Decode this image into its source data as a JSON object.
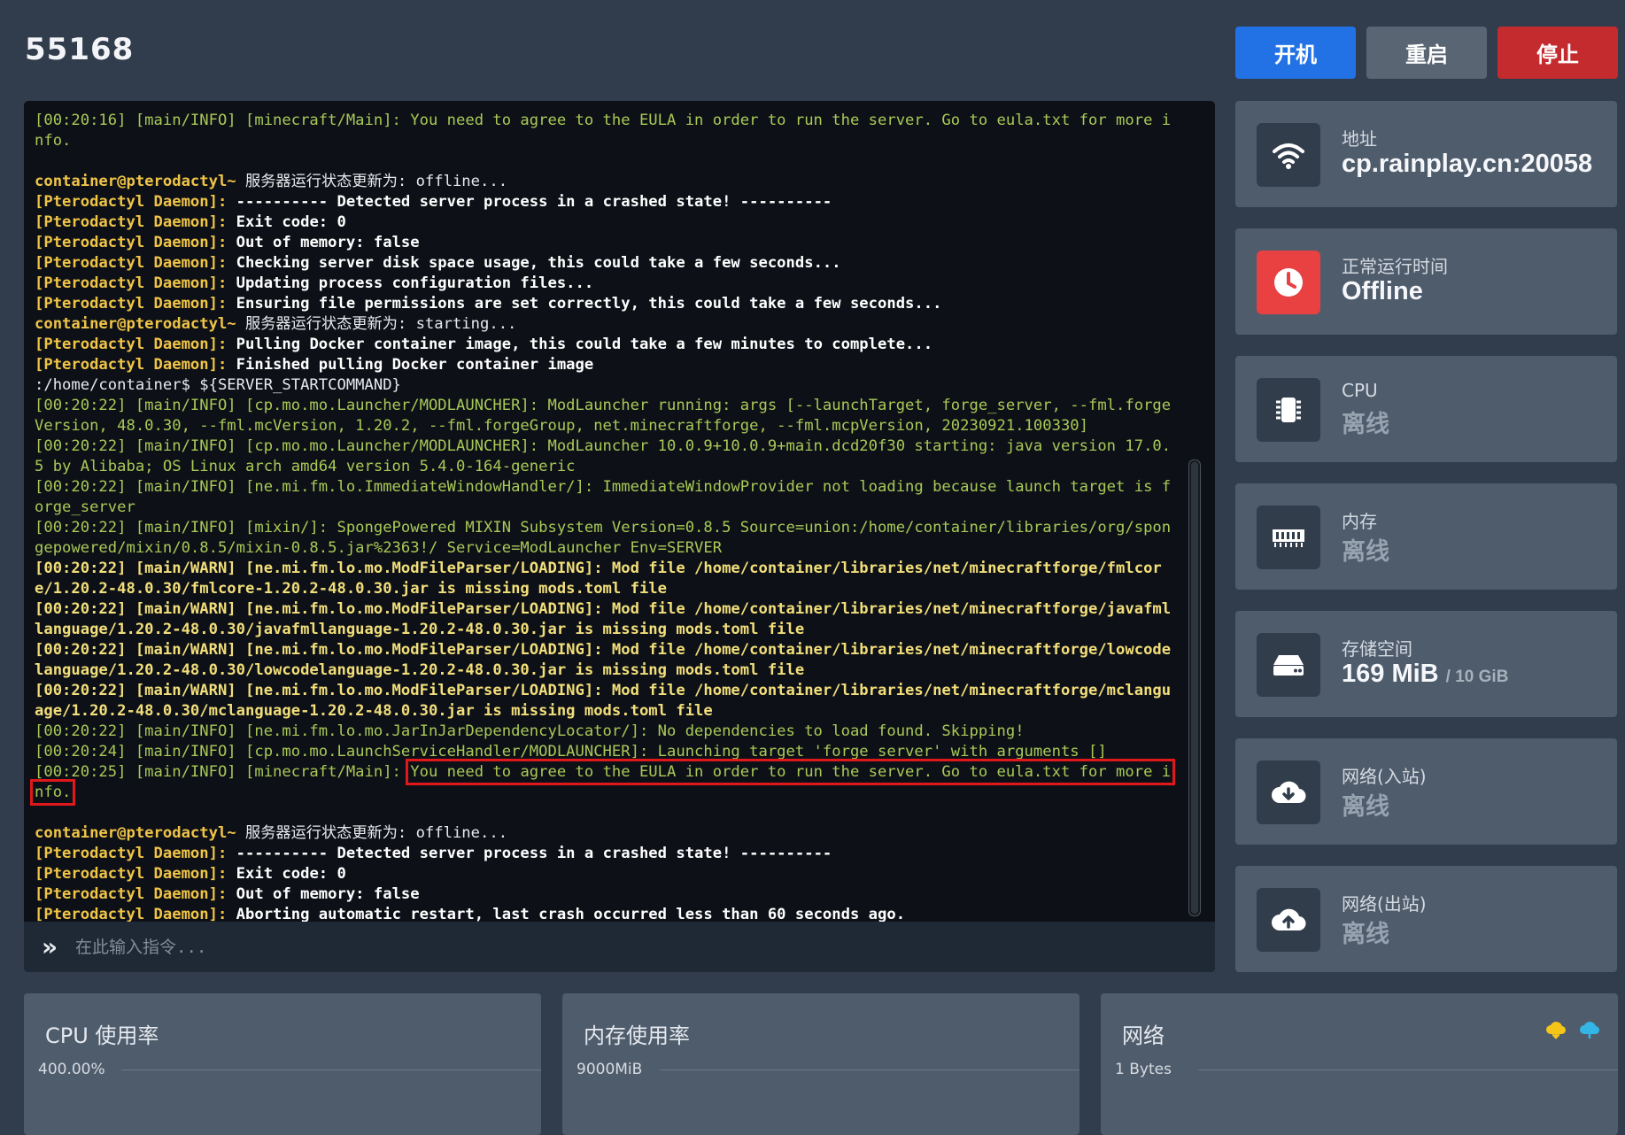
{
  "header": {
    "title": "55168",
    "buttons": {
      "start": "开机",
      "restart": "重启",
      "stop": "停止"
    }
  },
  "console": {
    "lines": [
      {
        "parts": [
          {
            "t": "[00:20:16] [main/INFO] [minecraft/Main]: You need to agree to the EULA in order to run the server. Go to eula.txt for more info.",
            "c": "info"
          }
        ]
      },
      {
        "parts": []
      },
      {
        "parts": [
          {
            "t": "container@pterodactyl~ ",
            "c": "prompt"
          },
          {
            "t": "服务器运行状态更新为: offline...",
            "c": "text"
          }
        ]
      },
      {
        "parts": [
          {
            "t": "[Pterodactyl Daemon]: ",
            "c": "prompt"
          },
          {
            "t": "---------- Detected server process in a crashed state! ----------",
            "c": "bold"
          }
        ]
      },
      {
        "parts": [
          {
            "t": "[Pterodactyl Daemon]: ",
            "c": "prompt"
          },
          {
            "t": "Exit code: 0",
            "c": "bold"
          }
        ]
      },
      {
        "parts": [
          {
            "t": "[Pterodactyl Daemon]: ",
            "c": "prompt"
          },
          {
            "t": "Out of memory: false",
            "c": "bold"
          }
        ]
      },
      {
        "parts": [
          {
            "t": "[Pterodactyl Daemon]: ",
            "c": "prompt"
          },
          {
            "t": "Checking server disk space usage, this could take a few seconds...",
            "c": "bold"
          }
        ]
      },
      {
        "parts": [
          {
            "t": "[Pterodactyl Daemon]: ",
            "c": "prompt"
          },
          {
            "t": "Updating process configuration files...",
            "c": "bold"
          }
        ]
      },
      {
        "parts": [
          {
            "t": "[Pterodactyl Daemon]: ",
            "c": "prompt"
          },
          {
            "t": "Ensuring file permissions are set correctly, this could take a few seconds...",
            "c": "bold"
          }
        ]
      },
      {
        "parts": [
          {
            "t": "container@pterodactyl~ ",
            "c": "prompt"
          },
          {
            "t": "服务器运行状态更新为: starting...",
            "c": "text"
          }
        ]
      },
      {
        "parts": [
          {
            "t": "[Pterodactyl Daemon]: ",
            "c": "prompt"
          },
          {
            "t": "Pulling Docker container image, this could take a few minutes to complete...",
            "c": "bold"
          }
        ]
      },
      {
        "parts": [
          {
            "t": "[Pterodactyl Daemon]: ",
            "c": "prompt"
          },
          {
            "t": "Finished pulling Docker container image",
            "c": "bold"
          }
        ]
      },
      {
        "parts": [
          {
            "t": ":/home/container$ ${SERVER_STARTCOMMAND}",
            "c": "text"
          }
        ]
      },
      {
        "parts": [
          {
            "t": "[00:20:22] [main/INFO] [cp.mo.mo.Launcher/MODLAUNCHER]: ModLauncher running: args [--launchTarget, forge_server, --fml.forgeVersion, 48.0.30, --fml.mcVersion, 1.20.2, --fml.forgeGroup, net.minecraftforge, --fml.mcpVersion, 20230921.100330]",
            "c": "info"
          }
        ]
      },
      {
        "parts": [
          {
            "t": "[00:20:22] [main/INFO] [cp.mo.mo.Launcher/MODLAUNCHER]: ModLauncher 10.0.9+10.0.9+main.dcd20f30 starting: java version 17.0.5 by Alibaba; OS Linux arch amd64 version 5.4.0-164-generic",
            "c": "info"
          }
        ]
      },
      {
        "parts": [
          {
            "t": "[00:20:22] [main/INFO] [ne.mi.fm.lo.ImmediateWindowHandler/]: ImmediateWindowProvider not loading because launch target is forge_server",
            "c": "info"
          }
        ]
      },
      {
        "parts": [
          {
            "t": "[00:20:22] [main/INFO] [mixin/]: SpongePowered MIXIN Subsystem Version=0.8.5 Source=union:/home/container/libraries/org/spongepowered/mixin/0.8.5/mixin-0.8.5.jar%2363!/ Service=ModLauncher Env=SERVER",
            "c": "info"
          }
        ]
      },
      {
        "parts": [
          {
            "t": "[00:20:22] [main/WARN] [ne.mi.fm.lo.mo.ModFileParser/LOADING]: Mod file /home/container/libraries/net/minecraftforge/fmlcore/1.20.2-48.0.30/fmlcore-1.20.2-48.0.30.jar is missing mods.toml file",
            "c": "warn"
          }
        ]
      },
      {
        "parts": [
          {
            "t": "[00:20:22] [main/WARN] [ne.mi.fm.lo.mo.ModFileParser/LOADING]: Mod file /home/container/libraries/net/minecraftforge/javafmllanguage/1.20.2-48.0.30/javafmllanguage-1.20.2-48.0.30.jar is missing mods.toml file",
            "c": "warn"
          }
        ]
      },
      {
        "parts": [
          {
            "t": "[00:20:22] [main/WARN] [ne.mi.fm.lo.mo.ModFileParser/LOADING]: Mod file /home/container/libraries/net/minecraftforge/lowcodelanguage/1.20.2-48.0.30/lowcodelanguage-1.20.2-48.0.30.jar is missing mods.toml file",
            "c": "warn"
          }
        ]
      },
      {
        "parts": [
          {
            "t": "[00:20:22] [main/WARN] [ne.mi.fm.lo.mo.ModFileParser/LOADING]: Mod file /home/container/libraries/net/minecraftforge/mclanguage/1.20.2-48.0.30/mclanguage-1.20.2-48.0.30.jar is missing mods.toml file",
            "c": "warn"
          }
        ]
      },
      {
        "parts": [
          {
            "t": "[00:20:22] [main/INFO] [ne.mi.fm.lo.mo.JarInJarDependencyLocator/]: No dependencies to load found. Skipping!",
            "c": "info"
          }
        ]
      },
      {
        "parts": [
          {
            "t": "[00:20:24] [main/INFO] [cp.mo.mo.LaunchServiceHandler/MODLAUNCHER]: Launching target 'forge_server' with arguments []",
            "c": "info"
          }
        ]
      },
      {
        "parts": [
          {
            "t": "[00:20:25] [main/INFO] [minecraft/Main]: ",
            "c": "info"
          },
          {
            "t": "You need to agree to the EULA in order to run the server. Go to eula.txt for more info.",
            "c": "info",
            "hl": true
          }
        ]
      },
      {
        "parts": []
      },
      {
        "parts": [
          {
            "t": "container@pterodactyl~ ",
            "c": "prompt"
          },
          {
            "t": "服务器运行状态更新为: offline...",
            "c": "text"
          }
        ]
      },
      {
        "parts": [
          {
            "t": "[Pterodactyl Daemon]: ",
            "c": "prompt"
          },
          {
            "t": "---------- Detected server process in a crashed state! ----------",
            "c": "bold"
          }
        ]
      },
      {
        "parts": [
          {
            "t": "[Pterodactyl Daemon]: ",
            "c": "prompt"
          },
          {
            "t": "Exit code: 0",
            "c": "bold"
          }
        ]
      },
      {
        "parts": [
          {
            "t": "[Pterodactyl Daemon]: ",
            "c": "prompt"
          },
          {
            "t": "Out of memory: false",
            "c": "bold"
          }
        ]
      },
      {
        "parts": [
          {
            "t": "[Pterodactyl Daemon]: ",
            "c": "prompt"
          },
          {
            "t": "Aborting automatic restart, last crash occurred less than 60 seconds ago.",
            "c": "bold"
          }
        ]
      }
    ],
    "input_placeholder": "在此输入指令..."
  },
  "stats": {
    "address": {
      "label": "地址",
      "value": "cp.rainplay.cn:20058",
      "icon": "wifi-icon"
    },
    "uptime": {
      "label": "正常运行时间",
      "value": "Offline",
      "icon": "clock-icon"
    },
    "cpu": {
      "label": "CPU",
      "value": "离线",
      "icon": "cpu-chip-icon"
    },
    "memory": {
      "label": "内存",
      "value": "离线",
      "icon": "memory-icon"
    },
    "storage": {
      "label": "存储空间",
      "value": "169 MiB",
      "sub": "/ 10 GiB",
      "icon": "hard-drive-icon"
    },
    "net_in": {
      "label": "网络(入站)",
      "value": "离线",
      "icon": "cloud-download-icon"
    },
    "net_out": {
      "label": "网络(出站)",
      "value": "离线",
      "icon": "cloud-upload-icon"
    }
  },
  "panels": {
    "cpu": {
      "title": "CPU 使用率",
      "axis_max": "400.00%"
    },
    "memory": {
      "title": "内存使用率",
      "axis_max": "9000MiB"
    },
    "network": {
      "title": "网络",
      "axis_max": "1 Bytes"
    }
  },
  "colors": {
    "start": "#2272e6",
    "restart": "#5a6573",
    "stop": "#c42b2f",
    "info": "#a9c957",
    "warn": "#f2de7a",
    "prompt": "#f0c447",
    "highlight": "#e0181c",
    "net_in_icon": "#f5c518",
    "net_out_icon": "#33b5e5"
  }
}
